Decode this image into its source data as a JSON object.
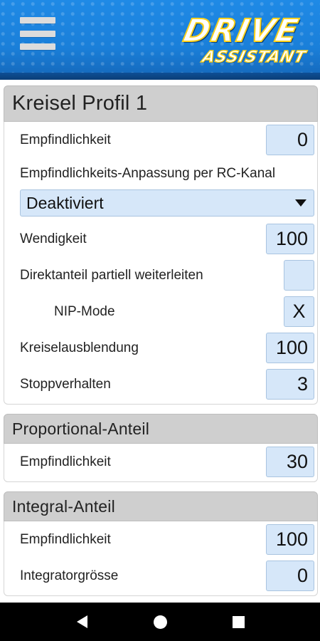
{
  "header": {
    "logo_line1": "DRIVE",
    "logo_line2": "ASSISTANT"
  },
  "sections": {
    "kreisel": {
      "title": "Kreisel Profil 1",
      "empfindlichkeit_label": "Empfindlichkeit",
      "empfindlichkeit_value": "0",
      "anpassung_label": "Empfindlichkeits-Anpassung per RC-Kanal",
      "anpassung_value": "Deaktiviert",
      "wendigkeit_label": "Wendigkeit",
      "wendigkeit_value": "100",
      "direktanteil_label": "Direktanteil partiell weiterleiten",
      "direktanteil_value": "",
      "nip_label": "NIP-Mode",
      "nip_value": "X",
      "kreiselausblendung_label": "Kreiselausblendung",
      "kreiselausblendung_value": "100",
      "stoppverhalten_label": "Stoppverhalten",
      "stoppverhalten_value": "3"
    },
    "proportional": {
      "title": "Proportional-Anteil",
      "empfindlichkeit_label": "Empfindlichkeit",
      "empfindlichkeit_value": "30"
    },
    "integral": {
      "title": "Integral-Anteil",
      "empfindlichkeit_label": "Empfindlichkeit",
      "empfindlichkeit_value": "100",
      "integratorgroesse_label": "Integratorgrösse",
      "integratorgroesse_value": "0"
    }
  },
  "icons": {
    "menu": "hamburger-menu-icon",
    "back": "back-triangle-icon",
    "home": "home-circle-icon",
    "recents": "recents-square-icon"
  },
  "colors": {
    "header_blue": "#1a7fd9",
    "field_bg": "#d6e7f9",
    "section_head_bg": "#cfcfcf",
    "logo_yellow": "#ffd21a"
  }
}
